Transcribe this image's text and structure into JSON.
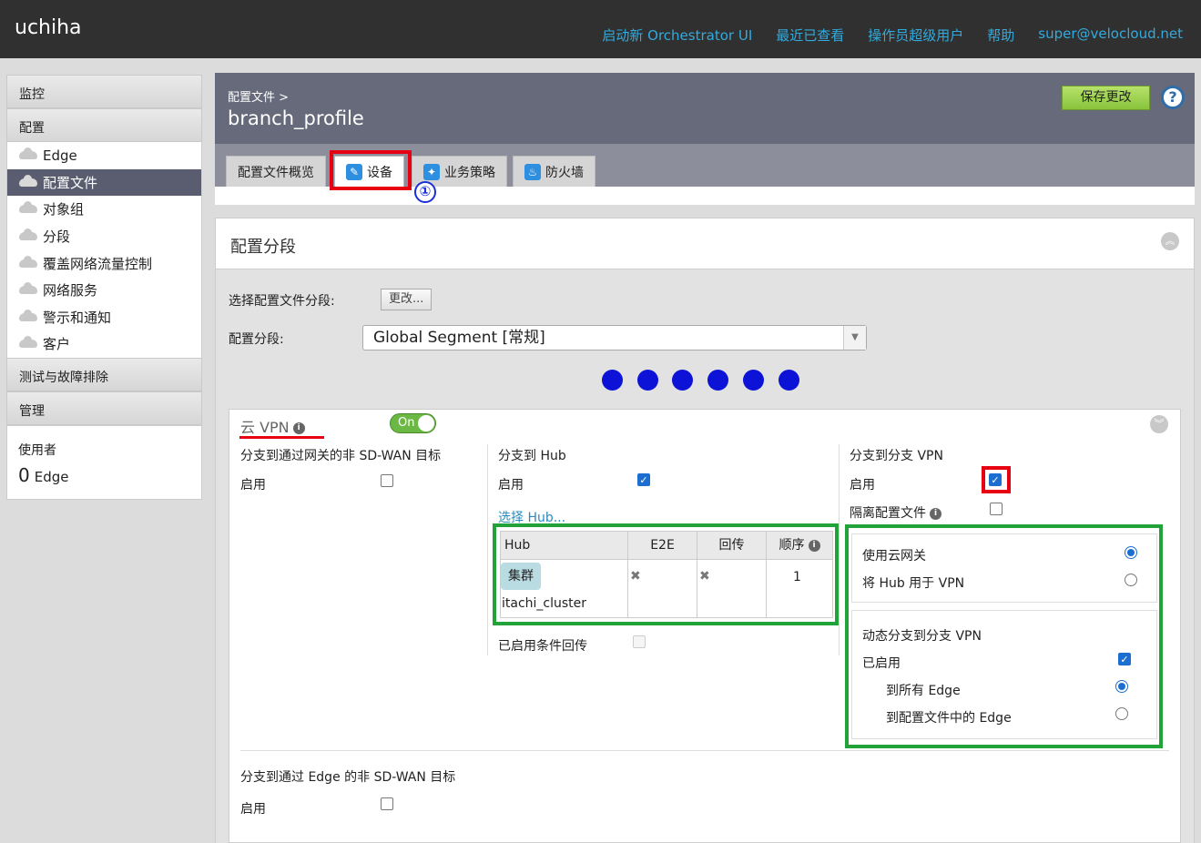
{
  "app": {
    "brand": "uchiha"
  },
  "topnav": [
    "启动新 Orchestrator UI",
    "最近已查看",
    "操作员超级用户",
    "帮助",
    "super@velocloud.net"
  ],
  "sidebar": {
    "section_monitor": "监控",
    "section_config": "配置",
    "items": [
      {
        "label": "Edge",
        "active": false
      },
      {
        "label": "配置文件",
        "active": true
      },
      {
        "label": "对象组",
        "active": false
      },
      {
        "label": "分段",
        "active": false
      },
      {
        "label": "覆盖网络流量控制",
        "active": false
      },
      {
        "label": "网络服务",
        "active": false
      },
      {
        "label": "警示和通知",
        "active": false
      },
      {
        "label": "客户",
        "active": false
      }
    ],
    "section_test": "测试与故障排除",
    "section_admin": "管理",
    "user_label": "使用者",
    "user_count": "0",
    "user_unit": "Edge"
  },
  "header": {
    "breadcrumb": "配置文件 >",
    "title": "branch_profile",
    "save_label": "保存更改",
    "help_label": "?"
  },
  "tabs": [
    {
      "label": "配置文件概览",
      "active": false,
      "icon": "none"
    },
    {
      "label": "设备",
      "active": true,
      "icon": "wrench-icon"
    },
    {
      "label": "业务策略",
      "active": false,
      "icon": "badge-icon"
    },
    {
      "label": "防火墙",
      "active": false,
      "icon": "flame-icon"
    }
  ],
  "callout_marker": "①",
  "segment_panel": {
    "title": "配置分段",
    "select_profile_segment_label": "选择配置文件分段:",
    "change_button": "更改...",
    "segment_label": "配置分段:",
    "segment_value": "Global Segment [常规]"
  },
  "cloud_vpn": {
    "title": "云 VPN",
    "toggle": "On",
    "branch_to_non_sdwan": {
      "title": "分支到通过网关的非 SD-WAN 目标",
      "enable_label": "启用",
      "enabled": false
    },
    "branch_to_hub": {
      "title": "分支到 Hub",
      "enable_label": "启用",
      "enabled": true,
      "select_hub_link": "选择 Hub...",
      "table_headers": [
        "Hub",
        "E2E",
        "回传",
        "顺序"
      ],
      "rows": [
        {
          "badge": "集群",
          "name": "itachi_cluster",
          "order": "1"
        }
      ],
      "conditional_backhaul_label": "已启用条件回传",
      "conditional_backhaul": false
    },
    "branch_to_branch": {
      "title": "分支到分支 VPN",
      "enable_label": "启用",
      "enabled": true,
      "isolate_label": "隔离配置文件",
      "isolate": false,
      "use_cloud_gateway": "使用云网关",
      "use_hub_for_vpn": "将 Hub 用于 VPN",
      "selected": "use_cloud_gateway",
      "dynamic_title": "动态分支到分支 VPN",
      "dynamic_enabled_label": "已启用",
      "dynamic_enabled": true,
      "to_all_edges": "到所有 Edge",
      "to_profile_edges": "到配置文件中的 Edge",
      "dynamic_selected": "to_all_edges"
    },
    "branch_to_non_sdwan_via_edge": {
      "title": "分支到通过 Edge 的非 SD-WAN 目标",
      "enable_label": "启用",
      "enabled": false
    }
  },
  "colors": {
    "topbar": "#303030",
    "link": "#33aadd",
    "header": "#676a7a",
    "save_button": "#9ed24f",
    "annotation_red": "#e60012",
    "annotation_green": "#22a33a",
    "annotation_blue": "#0c12d6",
    "checkbox_blue": "#1c6fd1"
  }
}
